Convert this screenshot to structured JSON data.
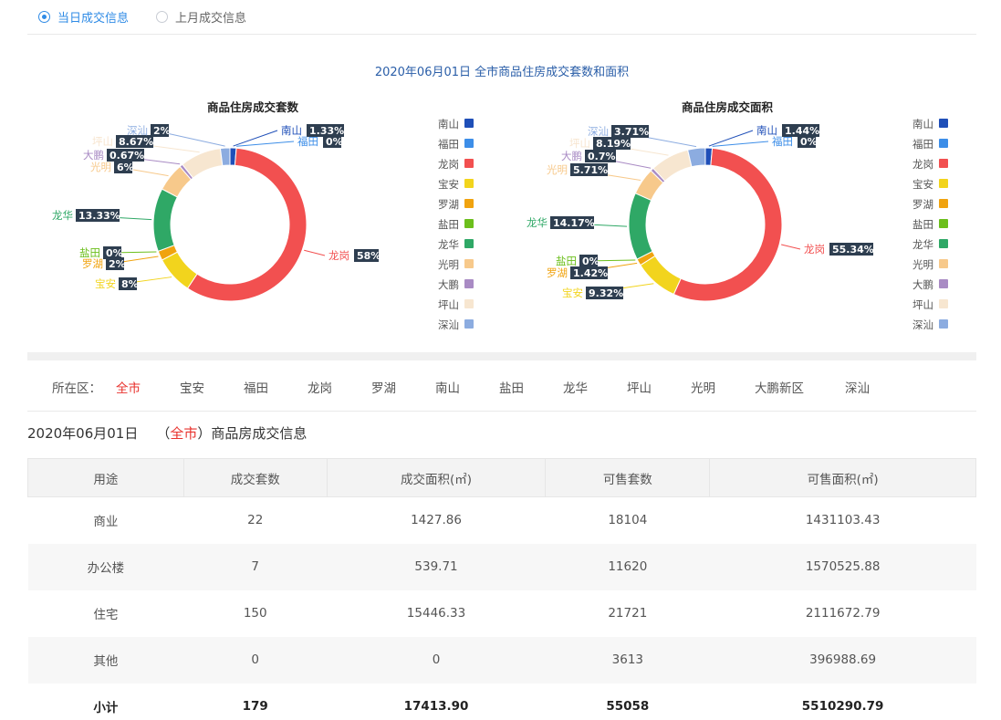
{
  "tabs": [
    {
      "label": "当日成交信息",
      "checked": true
    },
    {
      "label": "上月成交信息",
      "checked": false
    }
  ],
  "chart_section_title": "2020年06月01日 全市商品住房成交套数和面积",
  "districts": [
    "南山",
    "福田",
    "龙岗",
    "宝安",
    "罗湖",
    "盐田",
    "龙华",
    "光明",
    "大鹏",
    "坪山",
    "深汕"
  ],
  "colors": {
    "南山": "#1f4fb8",
    "福田": "#3d8ee8",
    "龙岗": "#f25050",
    "宝安": "#f2d41d",
    "罗湖": "#f0a30f",
    "盐田": "#6cbf1c",
    "龙华": "#2fa866",
    "光明": "#f7c98b",
    "大鹏": "#a98bc4",
    "坪山": "#f7e6d0",
    "深汕": "#8cace0",
    "accent": "#2f8be6",
    "active_red": "#e8322d",
    "label_bg": "#2e3e50"
  },
  "chart_data": [
    {
      "type": "pie",
      "title": "商品住房成交套数",
      "categories": [
        "南山",
        "福田",
        "龙岗",
        "宝安",
        "罗湖",
        "盐田",
        "龙华",
        "光明",
        "大鹏",
        "坪山",
        "深汕"
      ],
      "values": [
        1.33,
        0,
        58,
        8,
        2,
        0,
        13.33,
        6,
        0.67,
        8.67,
        2
      ],
      "labels": [
        "1.33%",
        "0%",
        "58%",
        "8%",
        "2%",
        "0%",
        "13.33%",
        "6%",
        "0.67%",
        "8.67%",
        "2%"
      ]
    },
    {
      "type": "pie",
      "title": "商品住房成交面积",
      "categories": [
        "南山",
        "福田",
        "龙岗",
        "宝安",
        "罗湖",
        "盐田",
        "龙华",
        "光明",
        "大鹏",
        "坪山",
        "深汕"
      ],
      "values": [
        1.44,
        0,
        55.34,
        9.32,
        1.42,
        0,
        14.17,
        5.71,
        0.7,
        8.19,
        3.71
      ],
      "labels": [
        "1.44%",
        "0%",
        "55.34%",
        "9.32%",
        "1.42%",
        "0%",
        "14.17%",
        "5.71%",
        "0.7%",
        "8.19%",
        "3.71%"
      ]
    }
  ],
  "district_filter": {
    "label": "所在区：",
    "items": [
      "全市",
      "宝安",
      "福田",
      "龙岗",
      "罗湖",
      "南山",
      "盐田",
      "龙华",
      "坪山",
      "光明",
      "大鹏新区",
      "深汕"
    ],
    "active": "全市"
  },
  "info_heading": {
    "date": "2020年06月01日",
    "open_paren": "（",
    "area": "全市",
    "close_paren": "）",
    "suffix": "商品房成交信息"
  },
  "table": {
    "headers": [
      "用途",
      "成交套数",
      "成交面积(㎡)",
      "可售套数",
      "可售面积(㎡)"
    ],
    "rows": [
      [
        "商业",
        "22",
        "1427.86",
        "18104",
        "1431103.43"
      ],
      [
        "办公楼",
        "7",
        "539.71",
        "11620",
        "1570525.88"
      ],
      [
        "住宅",
        "150",
        "15446.33",
        "21721",
        "2111672.79"
      ],
      [
        "其他",
        "0",
        "0",
        "3613",
        "396988.69"
      ]
    ],
    "total": [
      "小计",
      "179",
      "17413.90",
      "55058",
      "5510290.79"
    ]
  }
}
